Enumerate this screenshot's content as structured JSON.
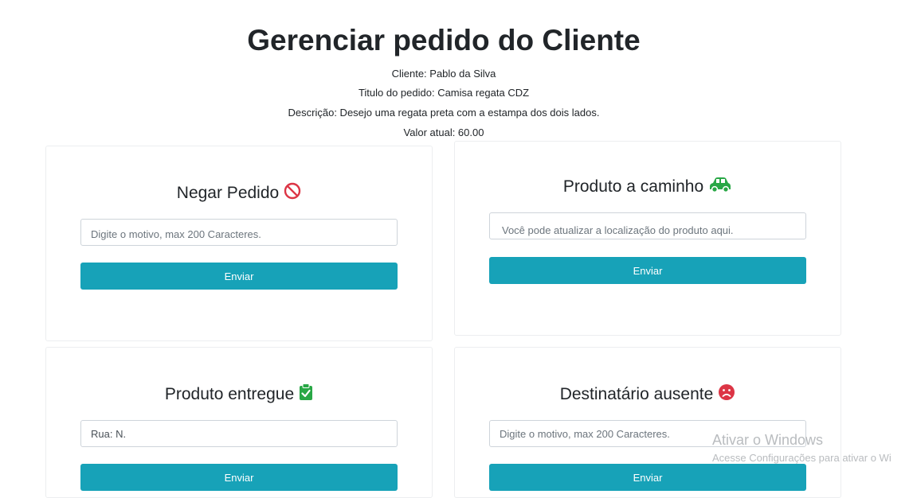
{
  "page": {
    "title": "Gerenciar pedido do Cliente",
    "cliente": "Cliente: Pablo da Silva",
    "titulo_pedido": "Titulo do pedido: Camisa regata CDZ",
    "descricao": "Descrição: Desejo uma regata preta com a estampa dos dois lados.",
    "valor": "Valor atual: 60.00"
  },
  "cards": {
    "negar": {
      "title": "Negar Pedido",
      "icon": "no-entry-icon",
      "input_value": "",
      "input_placeholder": "Digite o motivo, max 200 Caracteres.",
      "button": "Enviar"
    },
    "caminho": {
      "title": "Produto a caminho",
      "icon": "car-icon",
      "input_value": "",
      "input_placeholder": "Você pode atualizar a localização do produto aqui.",
      "button": "Enviar"
    },
    "entregue": {
      "title": "Produto entregue",
      "icon": "clipboard-check-icon",
      "input_value": "Rua: N.",
      "input_placeholder": "",
      "button": "Enviar"
    },
    "ausente": {
      "title": "Destinatário ausente",
      "icon": "sad-face-icon",
      "input_value": "",
      "input_placeholder": "Digite o motivo, max 200 Caracteres.",
      "button": "Enviar"
    }
  },
  "watermark": {
    "line1": "Ativar o Windows",
    "line2": "Acesse Configurações para ativar o Wi"
  },
  "colors": {
    "button": "#17a2b8",
    "danger": "#dc3545",
    "success": "#28a745"
  }
}
